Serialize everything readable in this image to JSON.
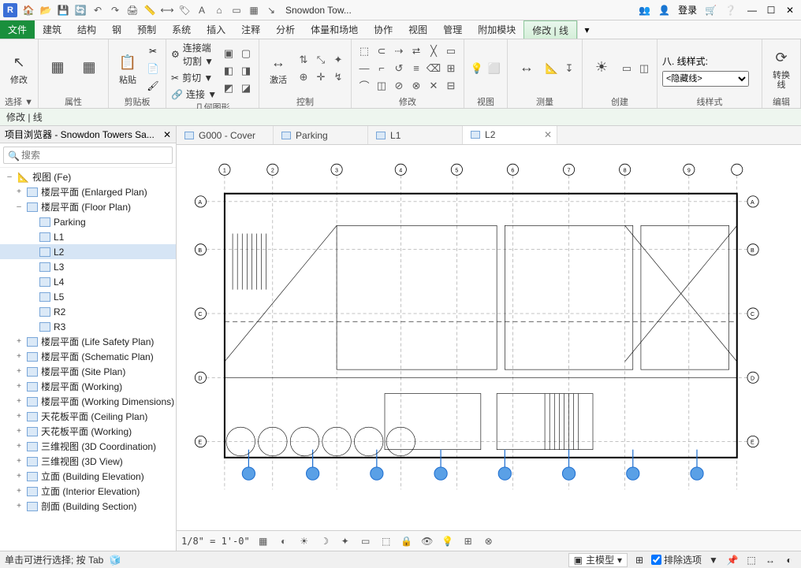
{
  "app": {
    "letter": "R",
    "title": "Snowdon Tow..."
  },
  "titlebar_right": {
    "login": "登录"
  },
  "menus": [
    "文件",
    "建筑",
    "结构",
    "钢",
    "预制",
    "系统",
    "插入",
    "注释",
    "分析",
    "体量和场地",
    "协作",
    "视图",
    "管理",
    "附加模块",
    "修改 | 线"
  ],
  "menu_file_index": 0,
  "menu_active_index": 14,
  "ribbon": {
    "groups": [
      {
        "label": "选择 ▼",
        "big": [
          {
            "icon": "↖",
            "label": "修改"
          }
        ]
      },
      {
        "label": "属性",
        "big": [
          {
            "icon": "▦",
            "label": ""
          },
          {
            "icon": "▦",
            "label": ""
          }
        ]
      },
      {
        "label": "剪贴板",
        "big": [
          {
            "icon": "📋",
            "label": "粘贴"
          }
        ],
        "side": [
          "✂",
          "📄",
          "🖌"
        ]
      },
      {
        "label": "几何图形",
        "lines": [
          {
            "icon": "⚙",
            "text": "连接端切割 ▼"
          },
          {
            "icon": "✂",
            "text": "剪切 ▼"
          },
          {
            "icon": "🔗",
            "text": "连接 ▼"
          }
        ],
        "extra": [
          "▣",
          "▢",
          "◧",
          "◨",
          "◩",
          "◪"
        ]
      },
      {
        "label": "控制",
        "big": [
          {
            "icon": "↔",
            "label": "激活"
          }
        ],
        "grid": [
          "⇅",
          "⤡",
          "✦",
          "⊕",
          "✛",
          "↯"
        ]
      },
      {
        "label": "修改",
        "grid": [
          "⬚",
          "⊂",
          "⇢",
          "⮂",
          "╳",
          "▭",
          "—",
          "⌐",
          "↺",
          "≡",
          "⌫",
          "⊞",
          "⌒",
          "◫",
          "⊘",
          "⊗",
          "✕",
          "⊟"
        ]
      },
      {
        "label": "视图",
        "grid": [
          "💡",
          "⬜"
        ]
      },
      {
        "label": "测量",
        "big": [
          {
            "icon": "↔",
            "label": ""
          }
        ],
        "grid": [
          "📐",
          "↧"
        ]
      },
      {
        "label": "创建",
        "big": [
          {
            "icon": "☀",
            "label": ""
          }
        ],
        "grid": [
          "▭",
          "◫"
        ]
      },
      {
        "label": "线样式",
        "linestyle": {
          "label": "八. 线样式:",
          "value": "<隐藏线>"
        }
      },
      {
        "label": "编辑",
        "big": [
          {
            "icon": "⟳",
            "label": "转换 线"
          }
        ]
      }
    ]
  },
  "contextbar": "修改 | 线",
  "sidebar": {
    "title": "项目浏览器 - Snowdon Towers Sa...",
    "search_placeholder": "搜索",
    "root": "视图 (Fe)",
    "groups": [
      {
        "tw": "+",
        "label": "楼层平面 (Enlarged Plan)"
      },
      {
        "tw": "–",
        "label": "楼层平面 (Floor Plan)",
        "children": [
          "Parking",
          "L1",
          "L2",
          "L3",
          "L4",
          "L5",
          "R2",
          "R3"
        ],
        "selected": "L2"
      },
      {
        "tw": "+",
        "label": "楼层平面 (Life Safety Plan)"
      },
      {
        "tw": "+",
        "label": "楼层平面 (Schematic Plan)"
      },
      {
        "tw": "+",
        "label": "楼层平面 (Site Plan)"
      },
      {
        "tw": "+",
        "label": "楼层平面 (Working)"
      },
      {
        "tw": "+",
        "label": "楼层平面 (Working Dimensions)"
      },
      {
        "tw": "+",
        "label": "天花板平面 (Ceiling Plan)"
      },
      {
        "tw": "+",
        "label": "天花板平面 (Working)"
      },
      {
        "tw": "+",
        "label": "三维视图 (3D Coordination)"
      },
      {
        "tw": "+",
        "label": "三维视图 (3D View)"
      },
      {
        "tw": "+",
        "label": "立面 (Building Elevation)"
      },
      {
        "tw": "+",
        "label": "立面 (Interior Elevation)"
      },
      {
        "tw": "+",
        "label": "剖面 (Building Section)"
      }
    ]
  },
  "tabs": [
    {
      "label": "G000 - Cover"
    },
    {
      "label": "Parking"
    },
    {
      "label": "L1"
    },
    {
      "label": "L2",
      "active": true
    }
  ],
  "viewbar": {
    "scale": "1/8\" = 1'-0\""
  },
  "statusbar": {
    "hint": "单击可进行选择; 按 Tab",
    "model_button": "主模型",
    "exclude": "排除选项"
  },
  "gridlabels_top": [
    "1",
    "2",
    "3",
    "4",
    "5",
    "6",
    "7",
    "8",
    "9"
  ],
  "gridlabels_left": [
    "A",
    "B",
    "C",
    "D",
    "E"
  ]
}
